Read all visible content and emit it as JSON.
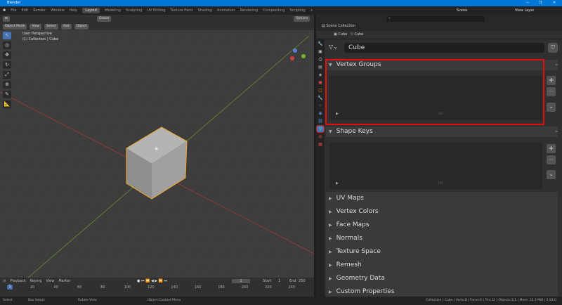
{
  "window": {
    "title": "Blender",
    "min": "—",
    "max": "❐",
    "close": "✕"
  },
  "menu": [
    "File",
    "Edit",
    "Render",
    "Window",
    "Help"
  ],
  "workspaces": [
    "Layout",
    "Modeling",
    "Sculpting",
    "UV Editing",
    "Texture Paint",
    "Shading",
    "Animation",
    "Rendering",
    "Compositing",
    "Scripting"
  ],
  "scene": "Scene",
  "view_layer": "View Layer",
  "viewport": {
    "mode": "Object Mode",
    "menus": [
      "View",
      "Select",
      "Add",
      "Object"
    ],
    "orientation": "Global",
    "options": "Options",
    "overlay_title": "User Perspective",
    "overlay_sub": "(1) Collection | Cube"
  },
  "outliner": {
    "root": "Scene Collection",
    "search_placeholder": ""
  },
  "properties": {
    "breadcrumb_object": "Cube",
    "breadcrumb_data": "Cube",
    "data_name": "Cube",
    "vertex_groups": "Vertex Groups",
    "shape_keys": "Shape Keys",
    "collapsed": [
      "UV Maps",
      "Vertex Colors",
      "Face Maps",
      "Normals",
      "Texture Space",
      "Remesh",
      "Geometry Data",
      "Custom Properties"
    ]
  },
  "timeline": {
    "menus": [
      "Playback",
      "Keying",
      "View",
      "Marker"
    ],
    "current": "1",
    "start_label": "Start",
    "start": "1",
    "end_label": "End",
    "end": "250",
    "ticks": [
      "20",
      "40",
      "60",
      "80",
      "100",
      "120",
      "140",
      "160",
      "180",
      "200",
      "220",
      "240"
    ]
  },
  "status": {
    "select": "Select",
    "box": "Box Select",
    "rotate": "Rotate View",
    "context": "Object Context Menu",
    "info": "Collection | Cube | Verts:8 | Faces:6 | Tris:12 | Objects:1/1 | Mem: 15.3 MiB | 2.83.0"
  },
  "colors": {
    "accent": "#4772b3",
    "highlight": "#e01010",
    "selection": "#f5a623"
  }
}
